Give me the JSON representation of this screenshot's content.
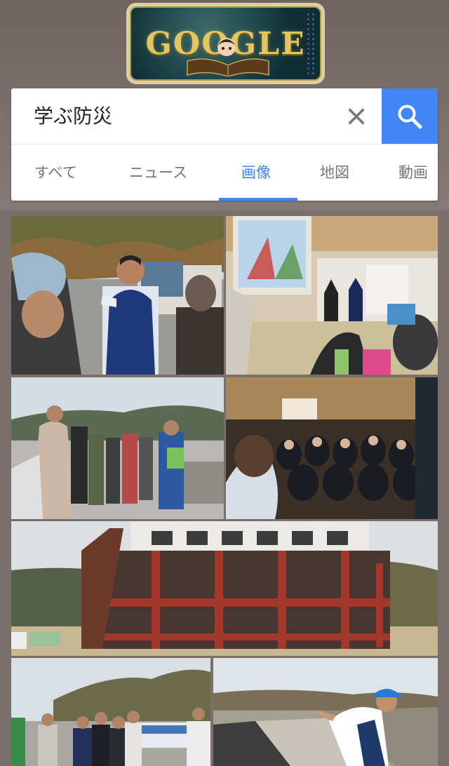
{
  "doodle": {
    "wordmark": "GOOGLE"
  },
  "search": {
    "query": "学ぶ防災"
  },
  "tabs": [
    {
      "label": "すべて"
    },
    {
      "label": "ニュース"
    },
    {
      "label": "画像"
    },
    {
      "label": "地図"
    },
    {
      "label": "動画"
    }
  ],
  "active_tab": "画像",
  "icons": {
    "clear": "close-icon",
    "search": "search-icon",
    "doodle": "google-doodle-logo"
  },
  "colors": {
    "accent": "#4285f4",
    "background": "#7a6f6b",
    "card": "#ffffff",
    "tab_inactive": "#777777"
  },
  "results": [
    {
      "subject": "guide with megaphone outdoors"
    },
    {
      "subject": "presentation in tatami room"
    },
    {
      "subject": "group walking tour by the sea"
    },
    {
      "subject": "students in dark room"
    },
    {
      "subject": "damaged building frame"
    },
    {
      "subject": "group near boats"
    },
    {
      "subject": "guide in blue cap at seawall"
    }
  ]
}
